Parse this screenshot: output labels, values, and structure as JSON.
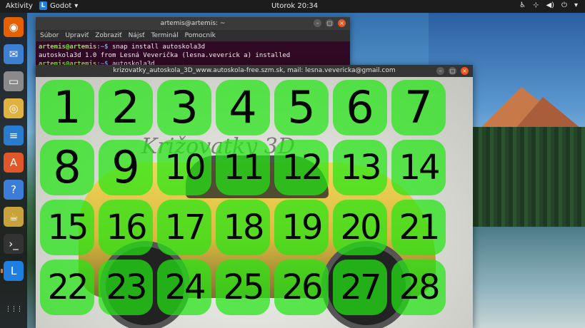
{
  "topbar": {
    "activities": "Aktivity",
    "app_name": "Godot",
    "app_icon_letter": "L",
    "clock": "Utorok 20:34"
  },
  "dock": {
    "items": [
      {
        "name": "firefox-icon",
        "glyph": "◉",
        "color": "#e66000"
      },
      {
        "name": "thunderbird-icon",
        "glyph": "✉",
        "color": "#3d7fd0"
      },
      {
        "name": "files-icon",
        "glyph": "▭",
        "color": "#8a8a8a"
      },
      {
        "name": "rhythmbox-icon",
        "glyph": "◎",
        "color": "#e0b340"
      },
      {
        "name": "libreoffice-writer-icon",
        "glyph": "≡",
        "color": "#2a7ccf"
      },
      {
        "name": "software-center-icon",
        "glyph": "A",
        "color": "#e2572a"
      },
      {
        "name": "help-icon",
        "glyph": "?",
        "color": "#3b7dd8"
      },
      {
        "name": "teapot-icon",
        "glyph": "☕",
        "color": "#c8a23a"
      },
      {
        "name": "terminal-icon",
        "glyph": "›_",
        "color": "#333333"
      },
      {
        "name": "autoskola-icon",
        "glyph": "L",
        "color": "#1e7fe0"
      }
    ],
    "show_apps_glyph": "⋮⋮⋮"
  },
  "terminal": {
    "title": "artemis@artemis: ~",
    "menu": [
      "Súbor",
      "Upraviť",
      "Zobraziť",
      "Nájsť",
      "Terminál",
      "Pomocník"
    ],
    "lines": [
      {
        "user": "artemis@artemis",
        "path": ":~$",
        "cmd": " snap install autoskola3d"
      },
      {
        "text": "autoskola3d 1.0 from Lesná Veverička (lesna.veverick a) installed"
      },
      {
        "user": "artemis@artemis",
        "path": ":~$",
        "cmd": " autoskola3d"
      }
    ]
  },
  "app": {
    "title": "krizovatky_autoskola_3D_www.autoskola-free.szm.sk, mail: lesna.vevericka@gmail.com",
    "logo_text": "Križovatky 3D",
    "tiles": [
      "1",
      "2",
      "3",
      "4",
      "5",
      "6",
      "7",
      "8",
      "9",
      "10",
      "11",
      "12",
      "13",
      "14",
      "15",
      "16",
      "17",
      "18",
      "19",
      "20",
      "21",
      "22",
      "23",
      "24",
      "25",
      "26",
      "27",
      "28"
    ]
  }
}
